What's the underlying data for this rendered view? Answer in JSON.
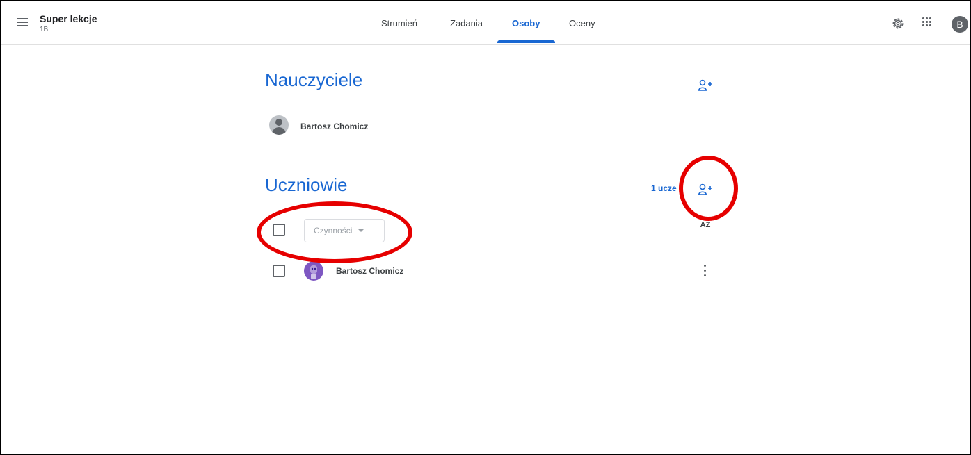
{
  "header": {
    "class_title": "Super lekcje",
    "class_section": "1B",
    "tabs": [
      {
        "label": "Strumień"
      },
      {
        "label": "Zadania"
      },
      {
        "label": "Osoby"
      },
      {
        "label": "Oceny"
      }
    ],
    "active_tab": "Osoby",
    "account_initial": "B",
    "icons": [
      "menu-icon",
      "settings-icon",
      "apps-icon"
    ]
  },
  "teachers": {
    "heading": "Nauczyciele",
    "people": [
      {
        "name": "Bartosz Chomicz"
      }
    ]
  },
  "students": {
    "heading": "Uczniowie",
    "count_label": "1 ucze",
    "actions_label": "Czynności",
    "sort_label": "AZ",
    "people": [
      {
        "name": "Bartosz Chomicz"
      }
    ]
  },
  "colors": {
    "accent": "#1967d2",
    "rule": "#8ab4f8",
    "annotation": "#e60000"
  }
}
